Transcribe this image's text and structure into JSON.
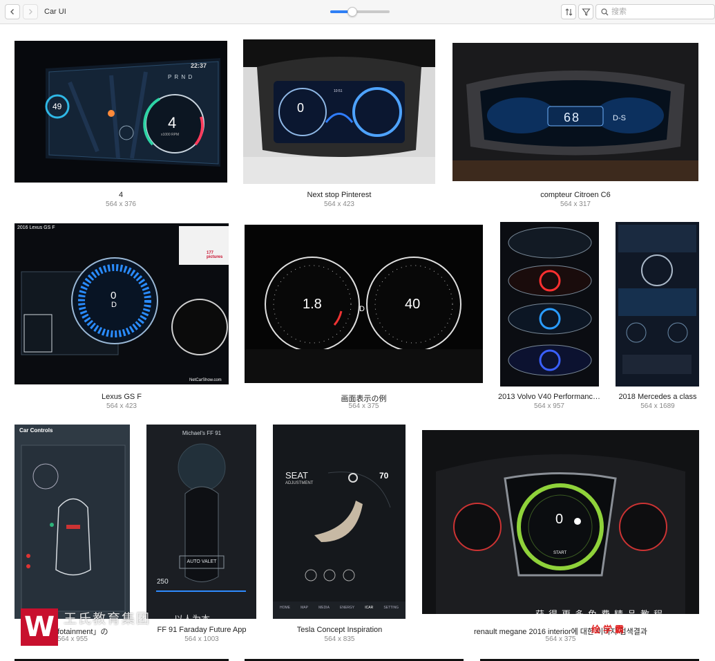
{
  "window": {
    "title": "Car UI"
  },
  "toolbar": {
    "zoom_slider_value": 0.37,
    "search_placeholder": "搜索"
  },
  "gallery": [
    {
      "caption": "4",
      "size": "564 x 376"
    },
    {
      "caption": "Next stop Pinterest",
      "size": "564 x 423"
    },
    {
      "caption": "compteur Citroen C6",
      "size": "564 x 317"
    },
    {
      "caption": "Lexus GS F",
      "size": "564 x 423"
    },
    {
      "caption": "画面表示の例",
      "size": "564 x 375"
    },
    {
      "caption": "2013 Volvo V40 Performanc…",
      "size": "564 x 957"
    },
    {
      "caption": "2018 Mercedes a class",
      "size": "564 x 1689"
    },
    {
      "caption": "「Vehicle infotainment」の",
      "size": "564 x 955"
    },
    {
      "caption": "FF 91 Faraday Future App",
      "size": "564 x 1003"
    },
    {
      "caption": "Tesla Concept Inspiration",
      "size": "564 x 835"
    },
    {
      "caption": "renault megane 2016 interior에 대한 이미지 검색결과",
      "size": "564 x 375"
    }
  ],
  "thumb_text": {
    "t1_speed": "4",
    "t1_time": "22:37",
    "t1_gears": "P R N D",
    "t1_left": "49",
    "t1_rpm": "x1000 RPM",
    "t2_speed": "0",
    "t2_time": "10:51",
    "t3_speed": "68",
    "t3_mode": "D-S",
    "t4_header": "2016 Lexus GS F",
    "t4_speed": "0",
    "t4_gear": "D",
    "t4_pictures": "177 pictures",
    "t4_site": "NetCarShow.com",
    "t5_rpm": "1.8",
    "t5_speed": "40",
    "t5_gear": "D",
    "t8_title": "Car Controls",
    "t9_title": "Michael's FF 91",
    "t9_btn": "AUTO VALET",
    "t9_energy": "250",
    "t10_seat": "SEAT",
    "t10_adj": "ADJUSTMENT",
    "t10_val": "70",
    "t10_nav": [
      "HOME",
      "MAP",
      "MEDIA",
      "ENERGY",
      "ICAR",
      "SETTING"
    ],
    "t11_speed": "0",
    "t11_start": "START"
  },
  "watermark": {
    "logo_letter": "W",
    "org": "王氏教育集团",
    "slogan": "以人为本",
    "right_text": "获得更多免费精品教程",
    "brand": "绘学霸"
  }
}
